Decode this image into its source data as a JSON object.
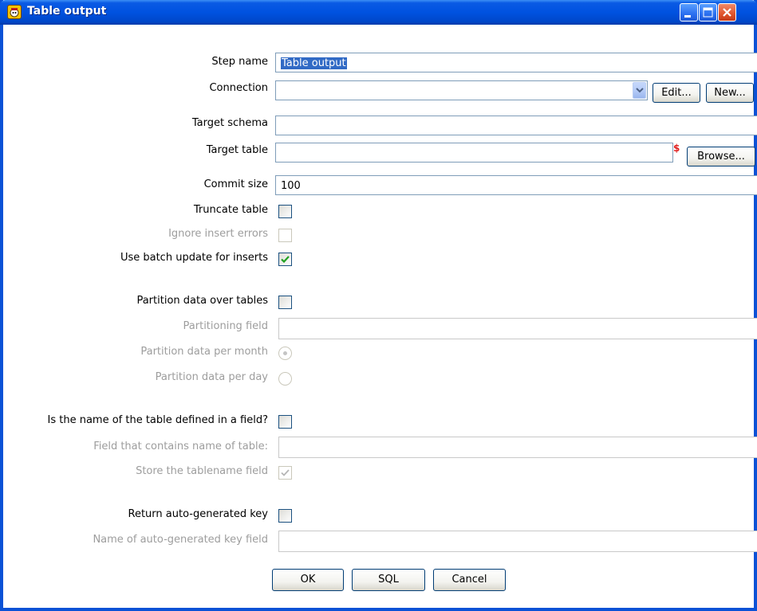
{
  "window": {
    "title": "Table output"
  },
  "form": {
    "step_name": {
      "label": "Step name",
      "value": "Table output"
    },
    "connection": {
      "label": "Connection",
      "value": "",
      "edit_label": "Edit...",
      "new_label": "New..."
    },
    "target_schema": {
      "label": "Target schema",
      "value": ""
    },
    "target_table": {
      "label": "Target table",
      "value": "",
      "variable_marker": "$",
      "browse_label": "Browse..."
    },
    "commit_size": {
      "label": "Commit size",
      "value": "100"
    },
    "truncate_table": {
      "label": "Truncate table",
      "checked": false
    },
    "ignore_insert_errors": {
      "label": "Ignore insert errors",
      "checked": false,
      "enabled": false
    },
    "use_batch_update": {
      "label": "Use batch update for inserts",
      "checked": true
    },
    "partition_data": {
      "label": "Partition data over tables",
      "checked": false
    },
    "partitioning_field": {
      "label": "Partitioning field",
      "value": "",
      "enabled": false
    },
    "partition_per_month": {
      "label": "Partition data per month",
      "selected": true,
      "enabled": false
    },
    "partition_per_day": {
      "label": "Partition data per day",
      "selected": false,
      "enabled": false
    },
    "table_name_in_field": {
      "label": "Is the name of the table defined in a field?",
      "checked": false
    },
    "table_name_field": {
      "label": "Field that contains name of table:",
      "value": "",
      "enabled": false
    },
    "store_tablename_field": {
      "label": "Store the tablename field",
      "checked": true,
      "enabled": false
    },
    "return_auto_key": {
      "label": "Return auto-generated key",
      "checked": false
    },
    "auto_key_field": {
      "label": "Name of auto-generated key field",
      "value": "",
      "enabled": false
    }
  },
  "buttons": {
    "ok": "OK",
    "sql": "SQL",
    "cancel": "Cancel"
  },
  "colors": {
    "titlebar": "#0052e0",
    "disabled_text": "#9d9d9d",
    "checkmark": "#21a121",
    "selection": "#316ac5"
  }
}
